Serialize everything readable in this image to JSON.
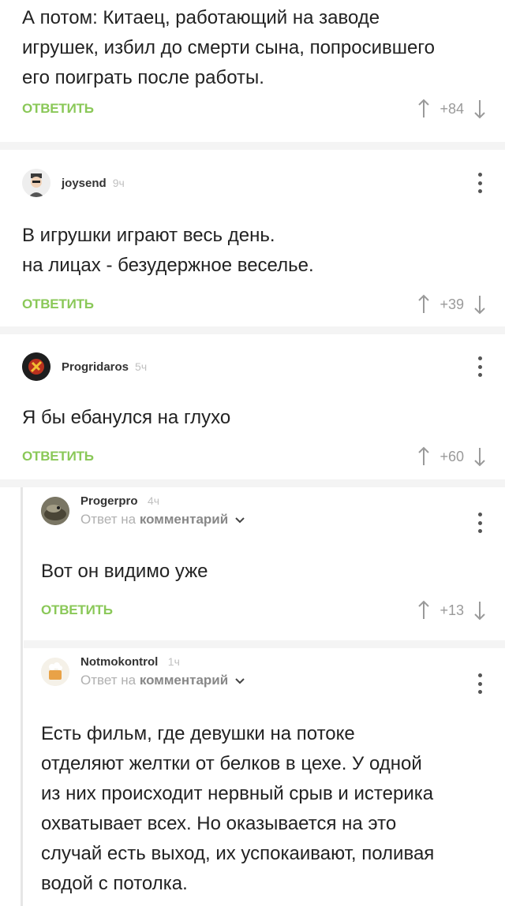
{
  "comments": [
    {
      "text": "А потом: Китаец, работающий на заводе\nигрушек, избил до смерти сына, попросившего\nего поиграть после работы.",
      "reply_label": "ОТВЕТИТЬ",
      "score": "+84"
    },
    {
      "author": "joysend",
      "time": "9ч",
      "text": "В игрушки играют весь день.\nна лицах - безудержное веселье.",
      "reply_label": "ОТВЕТИТЬ",
      "score": "+39"
    },
    {
      "author": "Progridaros",
      "time": "5ч",
      "text": "Я бы ебанулся на глухо",
      "reply_label": "ОТВЕТИТЬ",
      "score": "+60"
    },
    {
      "author": "Progerpro",
      "time": "4ч",
      "reply_to_prefix": "Ответ на",
      "reply_to_target": "комментарий",
      "text": "Вот он видимо уже",
      "reply_label": "ОТВЕТИТЬ",
      "score": "+13"
    },
    {
      "author": "Notmokontrol",
      "time": "1ч",
      "reply_to_prefix": "Ответ на",
      "reply_to_target": "комментарий",
      "text": "Есть фильм, где девушки на потоке\nотделяют желтки от белков в цехе. У одной\nиз них происходит нервный срыв и истерика\nохватывает всех. Но оказывается на это\nслучай есть выход, их успокаивают, поливая\nводой с потолка."
    }
  ],
  "colors": {
    "reply": "#8ac858",
    "score": "#9a9a9a",
    "time": "#c0c0c0",
    "divider": "#f4f4f4"
  },
  "icons": [
    "arrow-up-icon",
    "arrow-down-icon",
    "more-vertical-icon",
    "chevron-down-icon"
  ]
}
